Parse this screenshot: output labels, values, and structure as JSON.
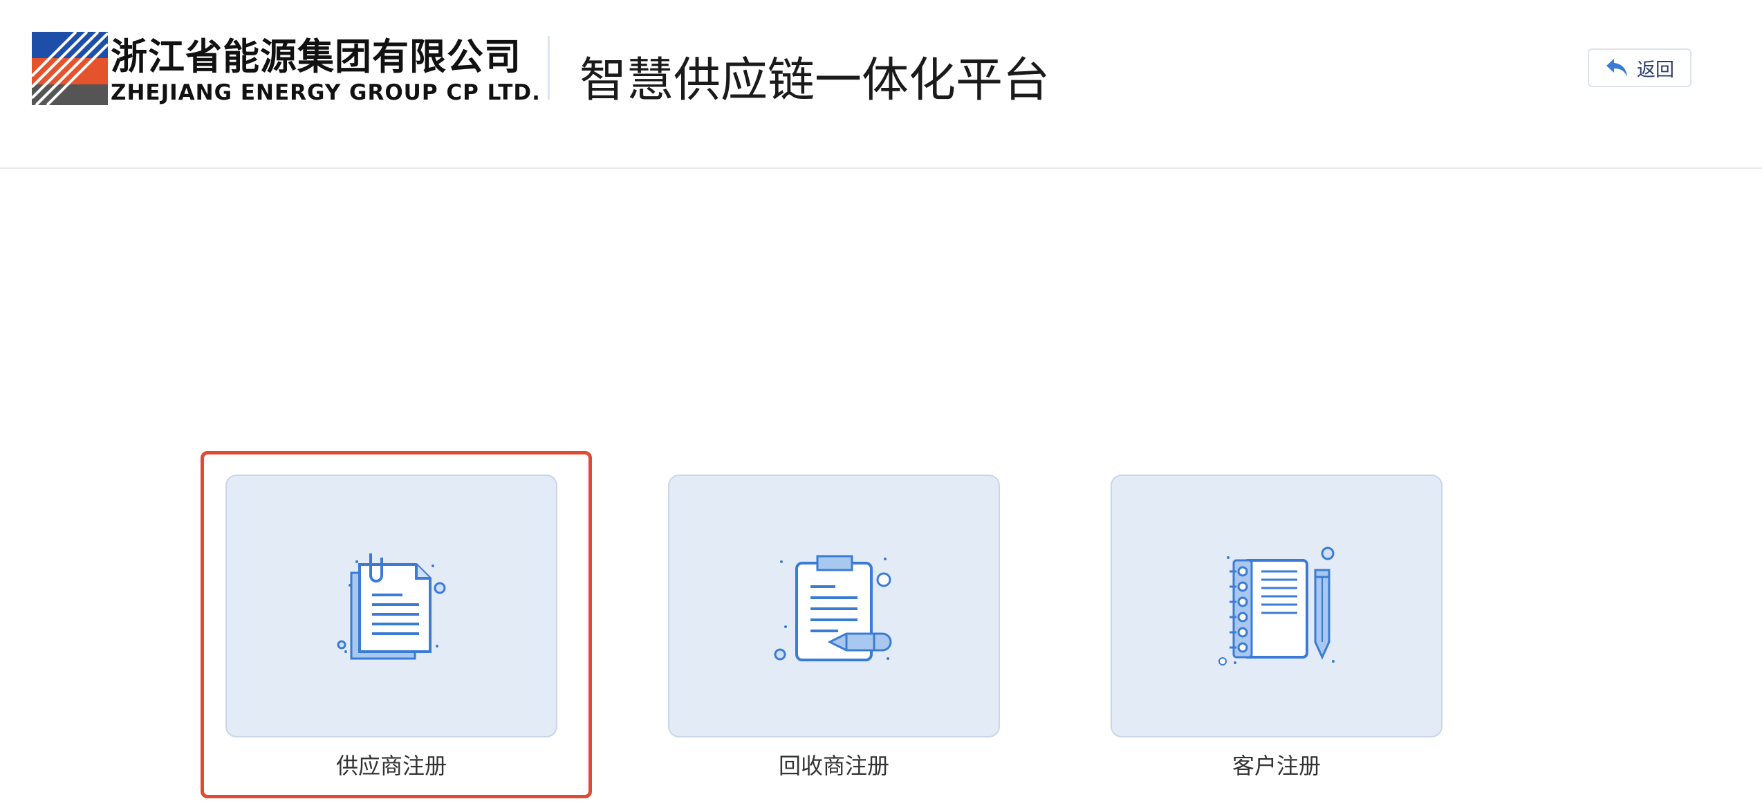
{
  "header": {
    "company_name_cn": "浙江省能源集团有限公司",
    "company_name_en": "ZHEJIANG ENERGY GROUP CP LTD.",
    "platform_title": "智慧供应链一体化平台",
    "back_button": {
      "label": "返回",
      "icon": "reply-arrow-icon"
    }
  },
  "registration_options": [
    {
      "label": "供应商注册",
      "icon": "document-stack-icon",
      "selected": true
    },
    {
      "label": "回收商注册",
      "icon": "clipboard-pen-icon",
      "selected": false
    },
    {
      "label": "客户注册",
      "icon": "notebook-pencil-icon",
      "selected": false
    }
  ],
  "colors": {
    "icon_blue": "#3a7bd5",
    "icon_fill": "#a9c8f0",
    "card_bg": "#e3ebf7",
    "selection_border": "#e04a32",
    "logo_blue": "#1d4fa8",
    "logo_orange": "#e5532d",
    "logo_gray": "#555555"
  }
}
